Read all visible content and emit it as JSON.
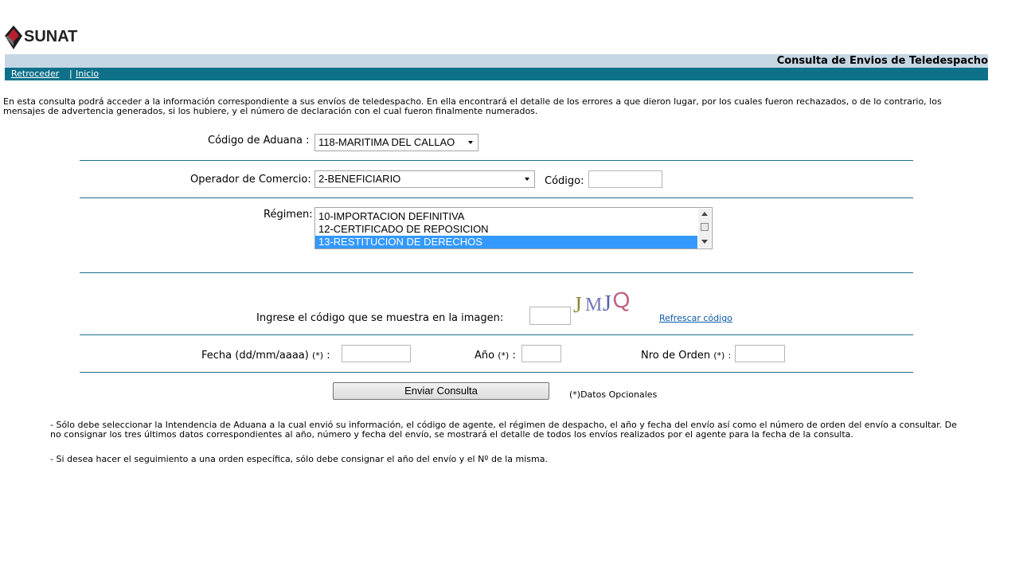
{
  "brand": {
    "name": "SUNAT"
  },
  "header": {
    "title": "Consulta de Envios de Teledespacho"
  },
  "nav": {
    "back": "Retroceder",
    "separator": "|",
    "home": "Inicio"
  },
  "intro": "En esta consulta podrá acceder a la información correspondiente a sus envíos de teledespacho. En ella encontrará el detalle de los errores a que dieron lugar, por los cuales fueron rechazados, o de lo contrario, los mensajes de advertencia generados, si los hubiere, y el número de declaración con el cual fueron finalmente numerados.",
  "form": {
    "aduana_label": "Código de Aduana :",
    "aduana_value": "118-MARITIMA DEL CALLAO",
    "operador_label": "Operador de Comercio:",
    "operador_value": "2-BENEFICIARIO",
    "codigo_label": "Código:",
    "regimen_label": "Régimen:",
    "regimen_options": [
      "10-IMPORTACION DEFINITIVA",
      "12-CERTIFICADO DE REPOSICION",
      "13-RESTITUCION DE DERECHOS"
    ],
    "regimen_selected": "13-RESTITUCION DE DERECHOS",
    "captcha_label": "Ingrese el código que se muestra en la imagen:",
    "captcha_text": "JMJQ",
    "refresh_link": "Refrescar código",
    "fecha_label": "Fecha (dd/mm/aaaa)",
    "anio_label": "Año",
    "orden_label": "Nro de Orden",
    "optional_mark": "(*)",
    "colon": ":",
    "submit": "Enviar Consulta",
    "optional_note": "(*)Datos Opcionales"
  },
  "notes": [
    "- Sólo debe seleccionar la Intendencia de Aduana a la cual envió su información, el código de agente, el régimen de  despacho, el año y fecha del envío así como el número de orden del envío a consultar. De no consignar los tres últimos datos correspondientes al año, número y fecha del envío, se mostrará el detalle de todos los envíos realizados por el agente para la fecha de la consulta.",
    "- Si desea hacer el seguimiento a una orden específica, sólo debe consignar el año del envío y el Nº de la misma."
  ],
  "colors": {
    "title_bar": "#c6d7e4",
    "nav_bar": "#0e7189",
    "divider": "#1f6f8e",
    "selection": "#3399ff"
  },
  "icons": [
    "sunat-logo-icon",
    "chevron-down-icon",
    "scroll-up-icon",
    "scroll-down-icon"
  ]
}
